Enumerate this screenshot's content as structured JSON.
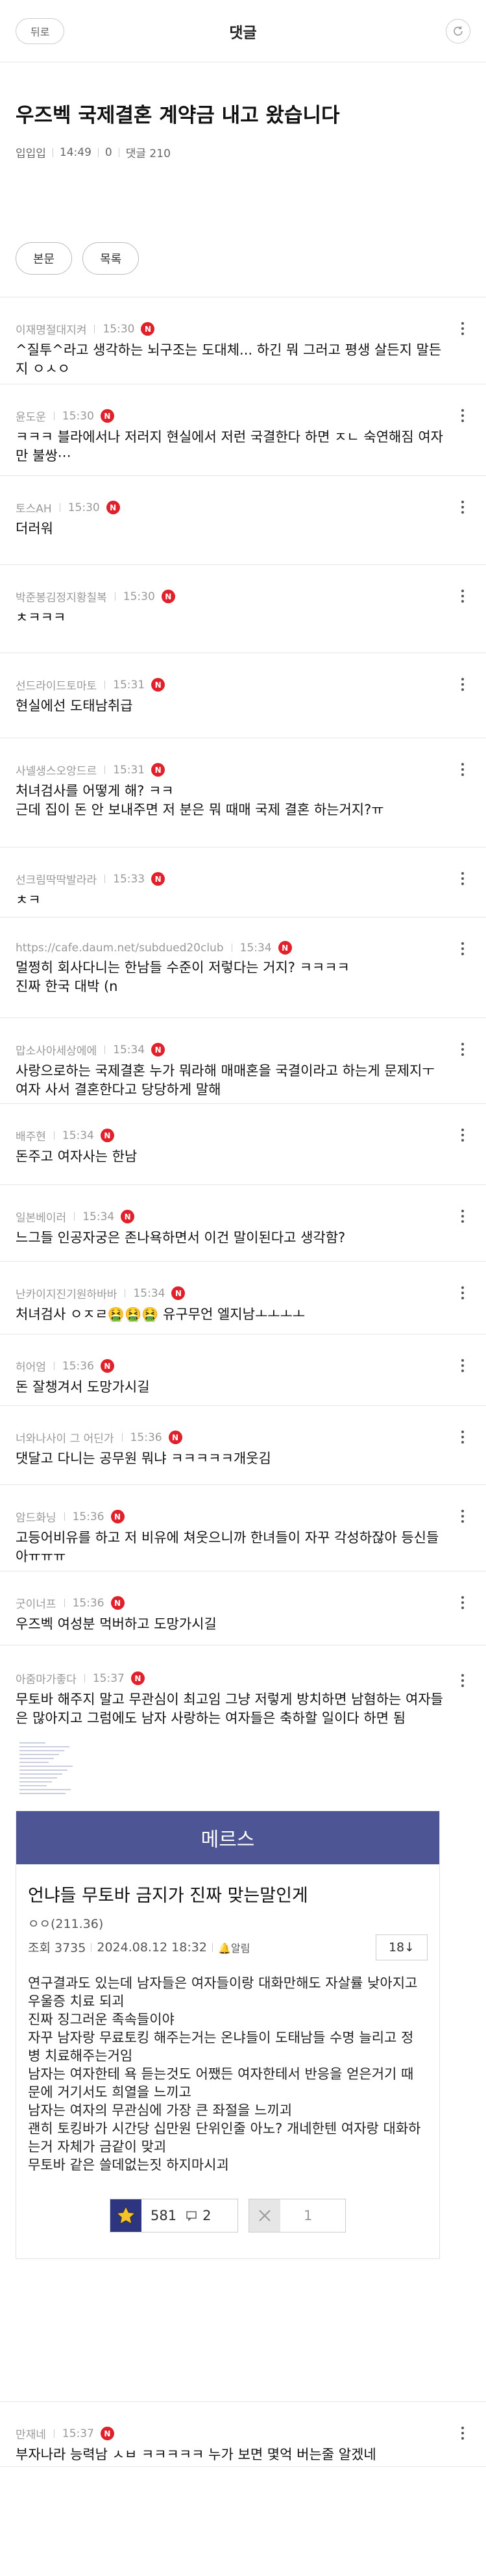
{
  "header": {
    "back_label": "뒤로",
    "title": "댓글"
  },
  "post": {
    "title": "우즈벡 국제결혼 계약금 내고 왔습니다",
    "author": "입입입",
    "time": "14:49",
    "views": "0",
    "comments_label": "댓글 210",
    "body_button": "본문",
    "list_button": "목록"
  },
  "comments": [
    {
      "nick": "이재명절대지켜",
      "time": "15:30",
      "text": "^질투^라고 생각하는 뇌구조는 도대체... 하긴 뭐 그러고 평생 살든지 말든지 ㅇㅅㅇ"
    },
    {
      "nick": "윤도운",
      "time": "15:30",
      "text": "ㅋㅋㅋ 블라에서나 저러지 현실에서 저런 국결한다 하면 ㅈㄴ 숙연해짐 여자만 불쌍⋯"
    },
    {
      "nick": "토스AH",
      "time": "15:30",
      "text": "더러워"
    },
    {
      "nick": "박준봉김정지황칠복",
      "time": "15:30",
      "text": "ㅊㅋㅋㅋ"
    },
    {
      "nick": "선드라이드토마토",
      "time": "15:31",
      "text": "현실에선 도태남취급"
    },
    {
      "nick": "사넬생스오앙드르",
      "time": "15:31",
      "text": "처녀검사를 어떻게 해? ㅋㅋ\n근데 집이 돈 안 보내주면 저 분은 뭐 때매 국제 결혼 하는거지?ㅠ"
    },
    {
      "nick": "선크림딱딱발라라",
      "time": "15:33",
      "text": "ㅊㅋ"
    },
    {
      "nick": "https://cafe.daum.net/subdued20club",
      "time": "15:34",
      "text": "멀쩡히 회사다니는 한남들 수준이 저렇다는 거지? ㅋㅋㅋㅋ\n진짜 한국 대박 (n"
    },
    {
      "nick": "맙소사아세상에에",
      "time": "15:34",
      "text": "사랑으로하는 국제결혼 누가 뭐라해 매매혼을 국결이라고 하는게 문제지ㅜ 여자 사서 결혼한다고 당당하게 말해"
    },
    {
      "nick": "배주현",
      "time": "15:34",
      "text": "돈주고 여자사는 한남"
    },
    {
      "nick": "일본베이러",
      "time": "15:34",
      "text": "느그들 인공자궁은 존나욕하면서 이건 말이된다고 생각함?"
    },
    {
      "nick": "난카이지진기원하바바",
      "time": "15:34",
      "text": "처녀검사 ㅇㅈㄹ🤮🤮🤮 유구무언 엘지남ㅗㅗㅗㅗ"
    },
    {
      "nick": "허어엄",
      "time": "15:36",
      "text": "돈 잘챙겨서 도망가시길"
    },
    {
      "nick": "너와나사이 그 어딘가",
      "time": "15:36",
      "text": "댓달고 다니는 공무원 뭐냐 ㅋㅋㅋㅋㅋ개웃김"
    },
    {
      "nick": "암드화닝",
      "time": "15:36",
      "text": "고등어비유를 하고 저 비유에 쳐웃으니까 한녀들이 자꾸 각성하잖아 등신들아ㅠㅠㅠ"
    },
    {
      "nick": "굿이너프",
      "time": "15:36",
      "text": "우즈벡 여성분 먹버하고 도망가시길"
    },
    {
      "nick": "아줌마가좋다",
      "time": "15:37",
      "text": "무토바 해주지 말고 무관심이 최고임 그냥 저렇게 방치하면 남혐하는 여자들은 많아지고 그럼에도 남자 사랑하는 여자들은 축하할 일이다 하면 됨"
    },
    {
      "nick": "만재네",
      "time": "15:37",
      "text": "부자나라 능력남 ㅅㅂ ㅋㅋㅋㅋㅋ 누가 보면 몇억 버는줄 알겠네"
    }
  ],
  "card": {
    "band": "메르스",
    "title": "언냐들 무토바 금지가 진짜 맞는말인게",
    "author": "ㅇㅇ(211.36)",
    "views": "조회 3735",
    "date": "2024.08.12 18:32",
    "alarm": "🔔알림",
    "page": "18↓",
    "content": "연구결과도 있는데 남자들은 여자들이랑 대화만해도 자살률 낮아지고 우울증 치료 되괴\n진짜 징그러운 족속들이야\n자꾸 남자랑 무료토킹 해주는거는 온냐들이 도태남들 수명 늘리고 정병 치료해주는거임\n남자는 여자한테 욕 듣는것도 어쨌든 여자한테서 반응을 얻은거기 때문에 거기서도 희열을 느끼고\n남자는 여자의 무관심에 가장 큰 좌절을 느끼괴\n괜히 토킹바가 시간당 십만원 단위인줄 아노? 개네한텐 여자랑 대화하는거 자체가 금같이 맞괴\n무토바 같은 쓸데없는짓 하지마시괴",
    "up_count": "581",
    "comment_count": "2",
    "down_count": "1"
  },
  "colors": {
    "accent_red": "#e0202a",
    "card_band": "#4e5594",
    "star_bg": "#2d3480",
    "star": "#f5c22a"
  }
}
